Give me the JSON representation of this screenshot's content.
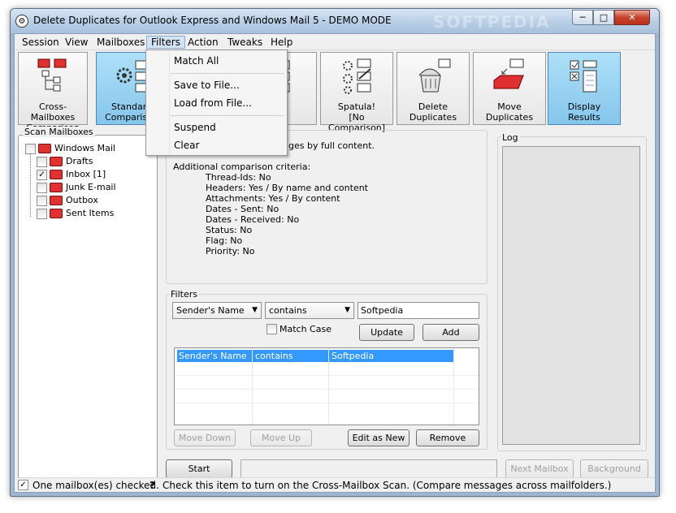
{
  "window": {
    "title": "Delete Duplicates for Outlook Express and Windows Mail 5 - DEMO MODE",
    "watermark": "SOFTPEDIA"
  },
  "caption": {
    "minimize": "─",
    "maximize": "□",
    "close": "✕"
  },
  "menu": {
    "items": [
      "Session",
      "View",
      "Mailboxes",
      "Filters",
      "Action",
      "Tweaks",
      "Help"
    ],
    "active": "Filters"
  },
  "filters_menu": {
    "items": [
      "Match All",
      "Save to File...",
      "Load from File...",
      "Suspend",
      "Clear"
    ]
  },
  "toolbar": {
    "buttons": [
      {
        "label1": "Cross-Mailboxes",
        "label2": "Comparison",
        "icon": "mailbox-tree-icon"
      },
      {
        "label1": "Standard",
        "label2": "Comparison",
        "icon": "gear-mail-icon"
      },
      {
        "label1": "ual",
        "label2": "rison",
        "icon": "mail-list-icon"
      },
      {
        "label1": "Spatula!",
        "label2": "[No Comparison]",
        "icon": "spatula-icon"
      },
      {
        "label1": "Delete",
        "label2": "Duplicates",
        "icon": "trash-can-icon"
      },
      {
        "label1": "Move",
        "label2": "Duplicates",
        "icon": "move-mail-icon"
      },
      {
        "label1": "Display",
        "label2": "Results",
        "icon": "checklist-icon"
      }
    ]
  },
  "scan": {
    "label": "Scan Mailboxes",
    "root": "Windows Mail",
    "folders": [
      {
        "name": "Drafts",
        "checked": false
      },
      {
        "name": "Inbox [1]",
        "checked": true
      },
      {
        "name": "Junk E-mail",
        "checked": false
      },
      {
        "name": "Outbox",
        "checked": false
      },
      {
        "name": "Sent Items",
        "checked": false
      }
    ]
  },
  "criteria": {
    "headline": "ges by full content.",
    "title": "Additional comparison criteria:",
    "lines": [
      "Thread-Ids: No",
      "Headers: Yes / By name and content",
      "Attachments: Yes / By content",
      "Dates - Sent: No",
      "Dates - Received: No",
      "Status: No",
      "Flag: No",
      "Priority: No"
    ]
  },
  "filters": {
    "label": "Filters",
    "field": "Sender's Name",
    "operator": "contains",
    "value": "Softpedia",
    "match_case": "Match Case",
    "update": "Update",
    "add": "Add",
    "rows": [
      {
        "field": "Sender's Name",
        "op": "contains",
        "value": "Softpedia"
      }
    ],
    "move_down": "Move Down",
    "move_up": "Move Up",
    "edit_as_new": "Edit as New",
    "remove": "Remove"
  },
  "log": {
    "label": "Log"
  },
  "actions": {
    "start": "Start",
    "next_mailbox": "Next Mailbox",
    "background": "Background"
  },
  "status": {
    "left": "One mailbox(es) checked.",
    "right": "Check this item to turn on the Cross-Mailbox Scan. (Compare messages across mailfolders.)"
  }
}
